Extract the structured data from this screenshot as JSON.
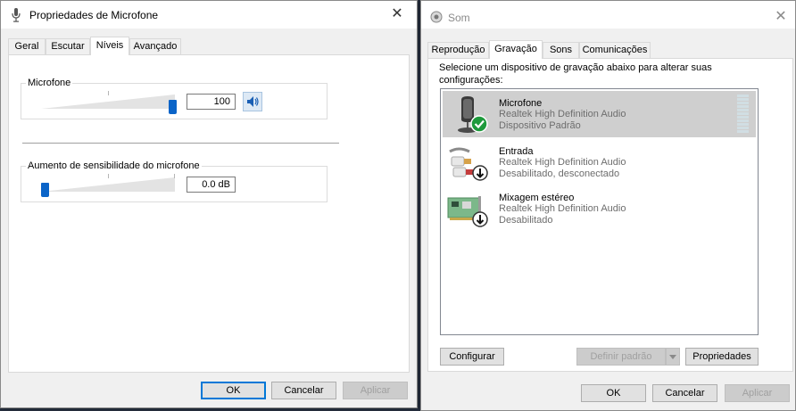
{
  "mic_dialog": {
    "title": "Propriedades de Microfone",
    "tabs": [
      {
        "label": "Geral"
      },
      {
        "label": "Escutar"
      },
      {
        "label": "Níveis"
      },
      {
        "label": "Avançado"
      }
    ],
    "active_tab": "Níveis",
    "microphone_group": {
      "label": "Microfone",
      "value": "100",
      "level_fraction": 1.0
    },
    "boost_group": {
      "label": "Aumento de sensibilidade do microfone",
      "value": "0.0 dB",
      "level_fraction": 0.0
    },
    "buttons": {
      "ok": "OK",
      "cancel": "Cancelar",
      "apply": "Aplicar"
    }
  },
  "sound_dialog": {
    "title": "Som",
    "tabs": [
      {
        "label": "Reprodução"
      },
      {
        "label": "Gravação"
      },
      {
        "label": "Sons"
      },
      {
        "label": "Comunicações"
      }
    ],
    "active_tab": "Gravação",
    "instruction": "Selecione um dispositivo de gravação abaixo para alterar suas configurações:",
    "devices": [
      {
        "name": "Microfone",
        "driver": "Realtek High Definition Audio",
        "status": "Dispositivo Padrão",
        "selected": true,
        "badge": "check"
      },
      {
        "name": "Entrada",
        "driver": "Realtek High Definition Audio",
        "status": "Desabilitado, desconectado",
        "selected": false,
        "badge": "down-arrow"
      },
      {
        "name": "Mixagem estéreo",
        "driver": "Realtek High Definition Audio",
        "status": "Desabilitado",
        "selected": false,
        "badge": "down-arrow"
      }
    ],
    "buttons": {
      "configure": "Configurar",
      "set_default": "Definir padrão",
      "properties": "Propriedades",
      "ok": "OK",
      "cancel": "Cancelar",
      "apply": "Aplicar"
    }
  },
  "colors": {
    "accent": "#0078d7",
    "thumb": "#0a64c8",
    "check_badge": "#1e9a3c"
  }
}
